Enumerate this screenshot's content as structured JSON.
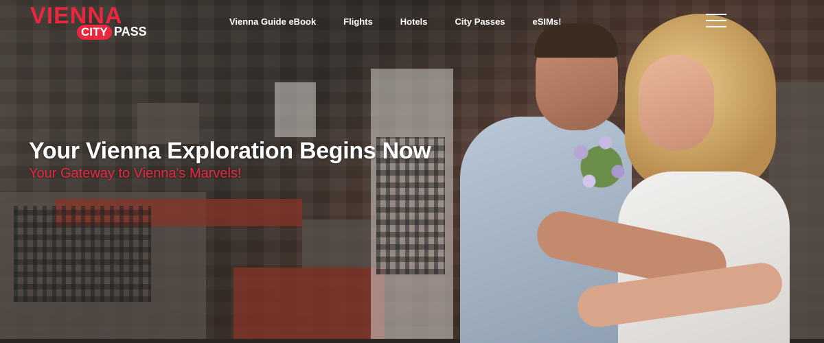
{
  "brand": {
    "name_top": "VIENNA",
    "name_badge": "CITY",
    "name_suffix": "PASS",
    "accent_color": "#e8283f"
  },
  "nav": {
    "items": [
      {
        "label": "Vienna Guide eBook"
      },
      {
        "label": "Flights"
      },
      {
        "label": "Hotels"
      },
      {
        "label": "City Passes"
      },
      {
        "label": "eSIMs!"
      }
    ],
    "menu_icon": "hamburger-menu-icon"
  },
  "hero": {
    "headline": "Your Vienna Exploration Begins Now",
    "subheadline": "Your Gateway to Vienna's Marvels!"
  }
}
